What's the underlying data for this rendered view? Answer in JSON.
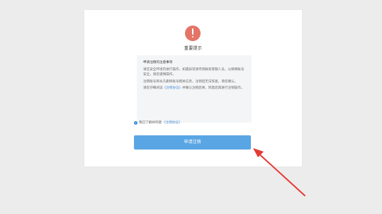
{
  "dialog": {
    "title": "重要提示",
    "notice": {
      "heading": "申请注销的注意事项",
      "paragraph1": "请在安全环境内进行操作，如遇异常请尽快联系客服人员，以保障账号安全，请您谨慎操作。",
      "paragraph2": "注销账号将永久删除账号相关信息，注销后无法恢复，请您确认。",
      "paragraph3_prefix": "请您仔细阅读",
      "paragraph3_link": "《注销协议》",
      "paragraph3_suffix": "并确认注销后果，同意后再进行注销操作。"
    },
    "agree": {
      "prefix": "我已了解并同意",
      "link": "《注销协议》"
    },
    "apply_button": "申请注销"
  },
  "colors": {
    "alert": "#e57468",
    "button": "#5aa6e4",
    "arrow": "#e53a34",
    "link": "#4a90d9"
  }
}
